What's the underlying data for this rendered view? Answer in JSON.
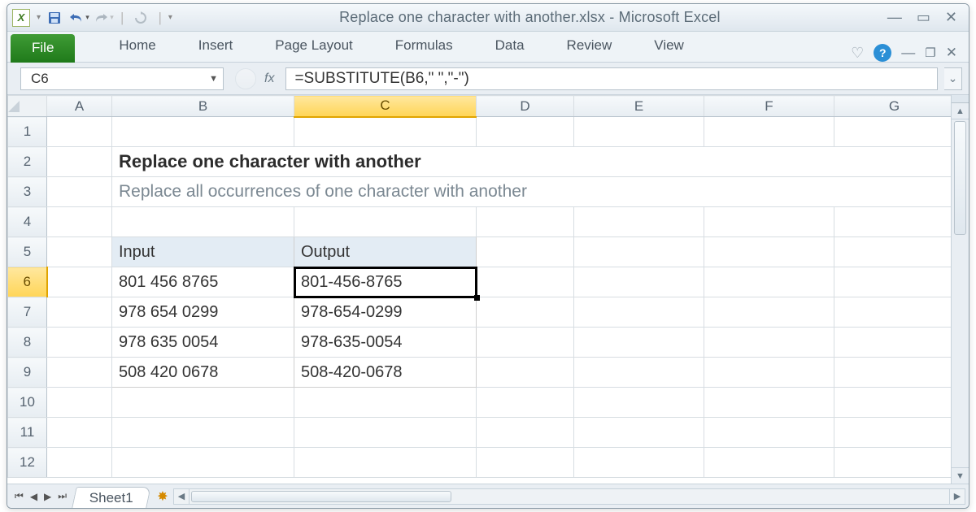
{
  "app": {
    "title": "Replace one character with another.xlsx  -  Microsoft Excel",
    "name": "Microsoft Excel"
  },
  "qat": {
    "save": "save-icon",
    "undo": "undo-icon",
    "redo": "redo-icon"
  },
  "ribbon": {
    "file": "File",
    "tabs": [
      "Home",
      "Insert",
      "Page Layout",
      "Formulas",
      "Data",
      "Review",
      "View"
    ]
  },
  "namebox": {
    "value": "C6"
  },
  "formula": {
    "value": "=SUBSTITUTE(B6,\" \",\"-\")",
    "fx": "fx"
  },
  "columns": [
    "A",
    "B",
    "C",
    "D",
    "E",
    "F",
    "G"
  ],
  "rows": [
    "1",
    "2",
    "3",
    "4",
    "5",
    "6",
    "7",
    "8",
    "9",
    "10",
    "11",
    "12"
  ],
  "selected": {
    "col": "C",
    "row": "6"
  },
  "content": {
    "title": "Replace one character with another",
    "subtitle": "Replace all occurrences of one character with another",
    "headers": {
      "input": "Input",
      "output": "Output"
    },
    "data": [
      {
        "input": "801 456 8765",
        "output": "801-456-8765"
      },
      {
        "input": "978 654 0299",
        "output": "978-654-0299"
      },
      {
        "input": "978 635 0054",
        "output": "978-635-0054"
      },
      {
        "input": "508 420 0678",
        "output": "508-420-0678"
      }
    ]
  },
  "sheets": {
    "active": "Sheet1"
  }
}
